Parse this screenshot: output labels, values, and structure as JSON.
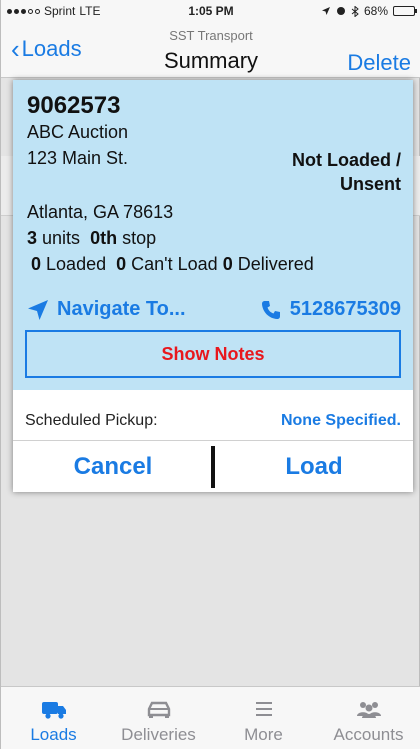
{
  "status_bar": {
    "carrier": "Sprint",
    "network": "LTE",
    "time": "1:05 PM",
    "battery": "68%",
    "battery_level": 0.68
  },
  "nav": {
    "back_label": "Loads",
    "subtitle": "SST Transport",
    "title": "Summary",
    "action_label": "Delete"
  },
  "load": {
    "id": "9062573",
    "customer": "ABC Auction",
    "address": "123 Main St.",
    "status": "Not Loaded / Unsent",
    "city": "Atlanta, GA 78613",
    "units_count": "3",
    "units_word": "units",
    "stop_ordinal": "0th",
    "stop_word": "stop",
    "loaded_count": "0",
    "loaded_label": "Loaded",
    "cant_load_count": "0",
    "cant_load_label": "Can't Load",
    "delivered_count": "0",
    "delivered_label": "Delivered",
    "navigate_label": "Navigate To...",
    "phone": "5128675309",
    "notes_button": "Show Notes",
    "pickup_label": "Scheduled Pickup:",
    "pickup_value": "None Specified.",
    "cancel_label": "Cancel",
    "load_label": "Load"
  },
  "colors": {
    "accent": "#1a7be3",
    "card_bg": "#bfe3f5",
    "notes_text": "#e8171d"
  },
  "tabs": [
    {
      "label": "Loads",
      "icon": "truck-icon",
      "active": true
    },
    {
      "label": "Deliveries",
      "icon": "car-icon",
      "active": false
    },
    {
      "label": "More",
      "icon": "menu-icon",
      "active": false
    },
    {
      "label": "Accounts",
      "icon": "people-icon",
      "active": false
    }
  ]
}
